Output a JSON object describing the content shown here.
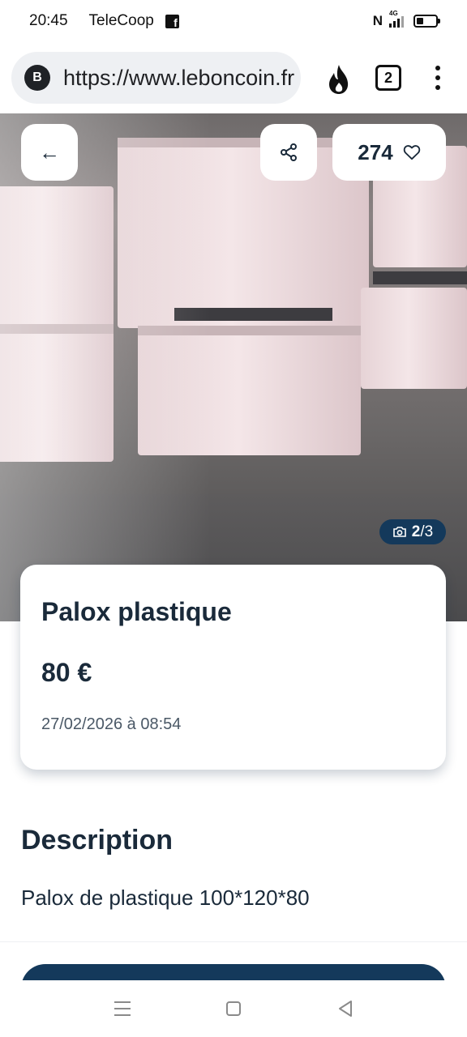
{
  "status_bar": {
    "time": "20:45",
    "carrier": "TeleCoop",
    "app_icon": "facebook-icon",
    "signal_label": "4G"
  },
  "browser": {
    "site_badge": "B",
    "url": "https://www.leboncoin.fr",
    "tab_count": "2",
    "icons": [
      "fire-icon",
      "tabs-icon",
      "more-vert-icon"
    ]
  },
  "listing": {
    "back_icon": "←",
    "favorites_count": "274",
    "photo_counter_current": "2",
    "photo_counter_total": "/3",
    "title": "Palox plastique",
    "price": "80 €",
    "date": "27/02/2026 à 08:54"
  },
  "description": {
    "heading": "Description",
    "text": "Palox de plastique 100*120*80"
  },
  "colors": {
    "brand_navy": "#14395b",
    "text_dark": "#1a2a3a"
  }
}
